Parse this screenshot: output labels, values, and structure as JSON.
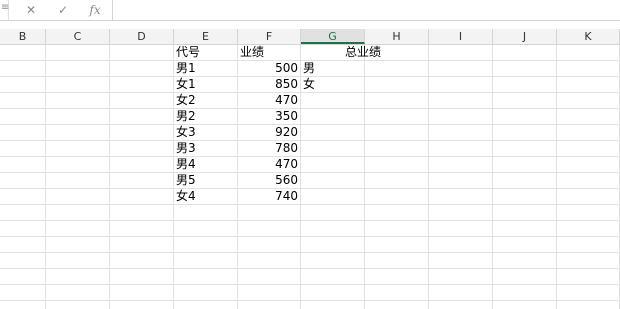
{
  "formula_bar": {
    "name_box_glyph": "≡",
    "cancel_icon": "✕",
    "confirm_icon": "✓",
    "fx_label": "fx",
    "value": ""
  },
  "columns": [
    "B",
    "C",
    "D",
    "E",
    "F",
    "G",
    "H",
    "I",
    "J",
    "K"
  ],
  "selected_column": "G",
  "cells": {
    "E1": "代号",
    "F1": "业绩",
    "G1": "总业绩",
    "rows": [
      {
        "code": "男1",
        "score": "500",
        "g": "男"
      },
      {
        "code": "女1",
        "score": "850",
        "g": "女"
      },
      {
        "code": "女2",
        "score": "470",
        "g": ""
      },
      {
        "code": "男2",
        "score": "350",
        "g": ""
      },
      {
        "code": "女3",
        "score": "920",
        "g": ""
      },
      {
        "code": "男3",
        "score": "780",
        "g": ""
      },
      {
        "code": "男4",
        "score": "470",
        "g": ""
      },
      {
        "code": "男5",
        "score": "560",
        "g": ""
      },
      {
        "code": "女4",
        "score": "740",
        "g": ""
      }
    ]
  },
  "colors": {
    "accent": "#217346",
    "header_bg": "#f3f3f3",
    "gridline": "#e1e1e1"
  }
}
